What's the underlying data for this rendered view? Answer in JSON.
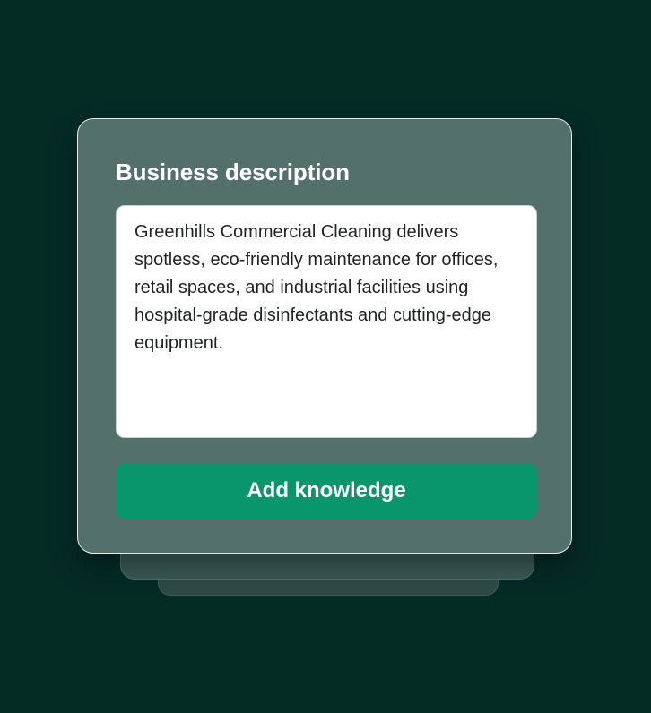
{
  "colors": {
    "background": "#052b25",
    "card": "#53706b",
    "accent": "#08966a",
    "text_primary": "#ffffff",
    "text_body": "#1f2422"
  },
  "card": {
    "title": "Business description",
    "description_value": "Greenhills Commercial Cleaning delivers spotless, eco-friendly maintenance for offices, retail spaces, and industrial facilities using hospital-grade disinfectants and cutting-edge equipment.",
    "action_label": "Add knowledge"
  }
}
